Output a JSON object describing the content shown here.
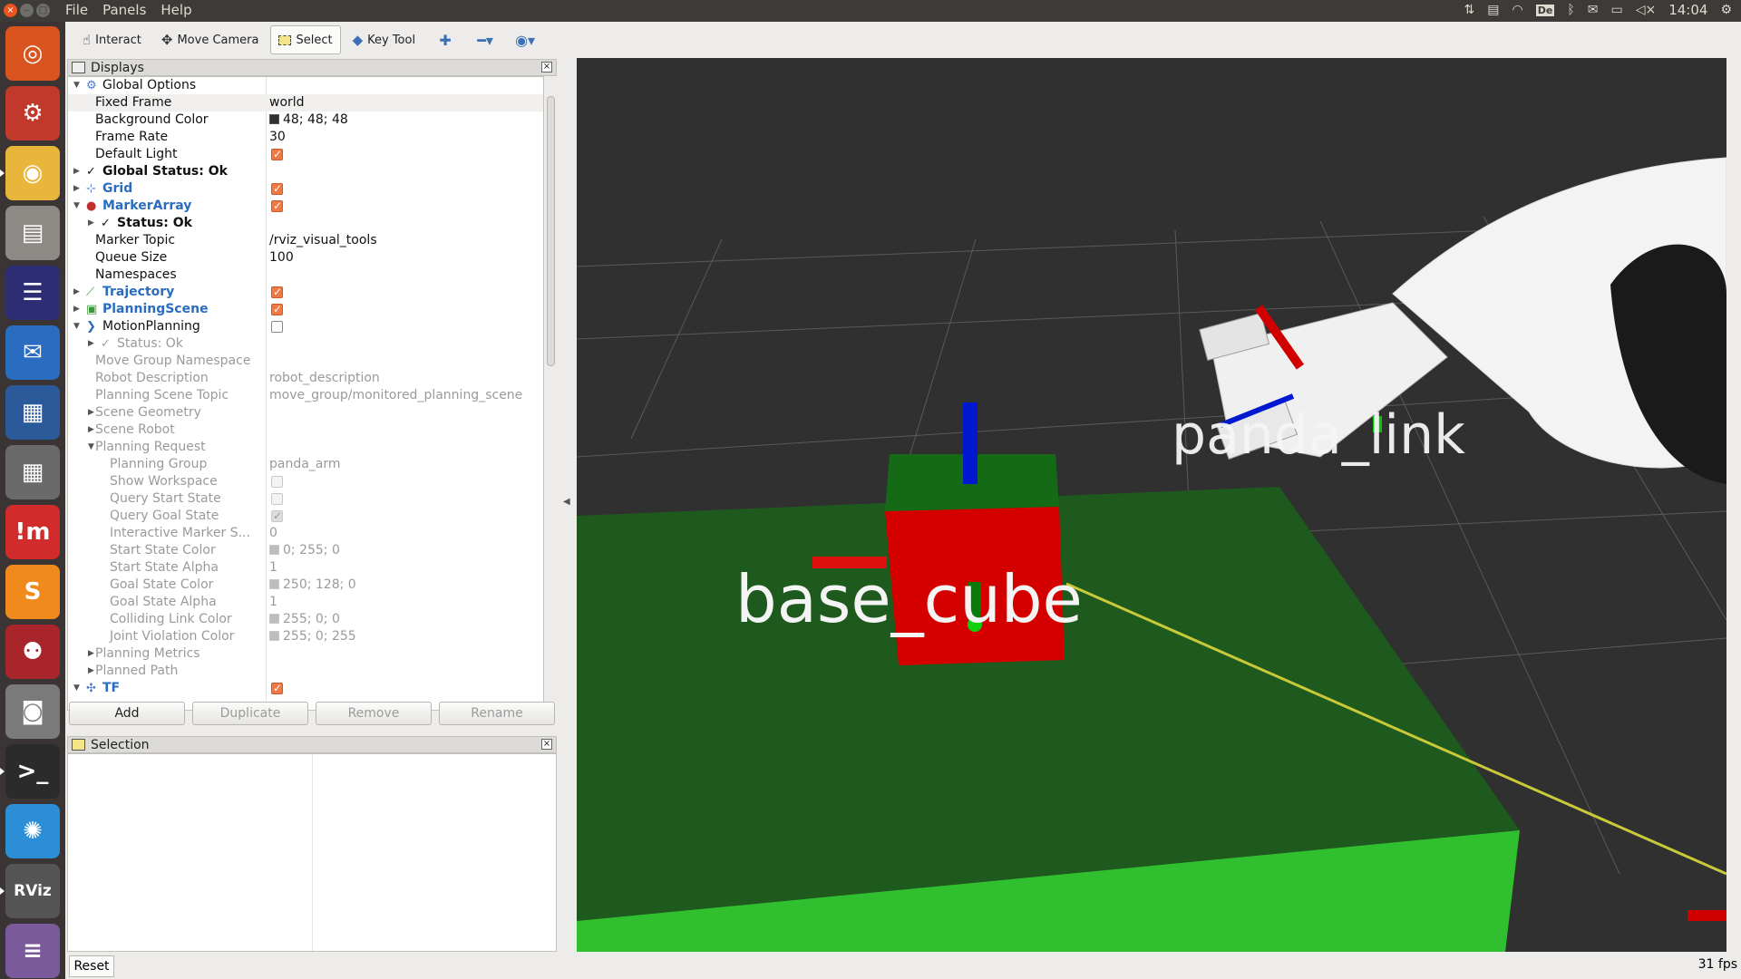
{
  "topbar": {
    "menus": [
      "File",
      "Panels",
      "Help"
    ],
    "keyboard_layout": "De",
    "clock": "14:04"
  },
  "launcher": [
    {
      "name": "ubuntu-dash",
      "glyph": "◎",
      "color": "#d9541e"
    },
    {
      "name": "system-settings",
      "glyph": "⚙",
      "color": "#c0392b"
    },
    {
      "name": "chrome",
      "glyph": "◉",
      "color": "#e8b63a"
    },
    {
      "name": "files",
      "glyph": "▤",
      "color": "#8d8a85"
    },
    {
      "name": "eclipse",
      "glyph": "☰",
      "color": "#2c2d72"
    },
    {
      "name": "thunderbird",
      "glyph": "✉",
      "color": "#2a6cbf"
    },
    {
      "name": "virtualbox",
      "glyph": "▦",
      "color": "#2a5a9a"
    },
    {
      "name": "calculator",
      "glyph": "▦",
      "color": "#6a6a6a"
    },
    {
      "name": "impress",
      "glyph": "!m",
      "color": "#d12b2b"
    },
    {
      "name": "sublime-text",
      "glyph": "S",
      "color": "#f08a1c"
    },
    {
      "name": "mendeley",
      "glyph": "⚉",
      "color": "#a8262b"
    },
    {
      "name": "camera",
      "glyph": "◙",
      "color": "#7a7a7a"
    },
    {
      "name": "terminal",
      "glyph": ">_",
      "color": "#2b2b2b"
    },
    {
      "name": "splash",
      "glyph": "✺",
      "color": "#2b8ed6"
    },
    {
      "name": "rviz",
      "glyph": "RViz",
      "color": "#555555"
    },
    {
      "name": "stack",
      "glyph": "≡",
      "color": "#7a5a9a"
    }
  ],
  "toolbar": {
    "interact": "Interact",
    "move_camera": "Move Camera",
    "select": "Select",
    "key_tool": "Key Tool"
  },
  "displays_panel": {
    "title": "Displays",
    "rows": [
      {
        "indent": 0,
        "arrow": "down",
        "icon": "⚙",
        "icon_color": "#4a7bd0",
        "label": "Global Options",
        "value": "",
        "style": "",
        "alt": false
      },
      {
        "indent": 1,
        "arrow": "",
        "icon": "",
        "label": "Fixed Frame",
        "value": "world",
        "style": "",
        "alt": true
      },
      {
        "indent": 1,
        "arrow": "",
        "icon": "",
        "label": "Background Color",
        "value": "48; 48; 48",
        "swatch": "#303030",
        "style": "",
        "alt": false
      },
      {
        "indent": 1,
        "arrow": "",
        "icon": "",
        "label": "Frame Rate",
        "value": "30",
        "style": "",
        "alt": false
      },
      {
        "indent": 1,
        "arrow": "",
        "icon": "",
        "label": "Default Light",
        "check": "on",
        "style": "",
        "alt": false
      },
      {
        "indent": 0,
        "arrow": "right",
        "icon": "✓",
        "icon_color": "#111",
        "label": "Global Status: Ok",
        "value": "",
        "style": "bold",
        "alt": false
      },
      {
        "indent": 0,
        "arrow": "right",
        "icon": "⊹",
        "icon_color": "#4a7bd0",
        "label": "Grid",
        "check": "on",
        "style": "blue",
        "alt": false
      },
      {
        "indent": 0,
        "arrow": "down",
        "icon": "●",
        "icon_color": "#c03030",
        "label": "MarkerArray",
        "check": "on",
        "style": "blue",
        "alt": false
      },
      {
        "indent": 1,
        "arrow": "right",
        "icon": "✓",
        "icon_color": "#111",
        "label": "Status: Ok",
        "value": "",
        "style": "bold",
        "alt": false
      },
      {
        "indent": 1,
        "arrow": "",
        "icon": "",
        "label": "Marker Topic",
        "value": "/rviz_visual_tools",
        "style": "",
        "alt": false
      },
      {
        "indent": 1,
        "arrow": "",
        "icon": "",
        "label": "Queue Size",
        "value": "100",
        "style": "",
        "alt": false
      },
      {
        "indent": 1,
        "arrow": "",
        "icon": "",
        "label": "Namespaces",
        "value": "",
        "style": "",
        "alt": false
      },
      {
        "indent": 0,
        "arrow": "right",
        "icon": "⟋",
        "icon_color": "#2aa52a",
        "label": "Trajectory",
        "check": "on",
        "style": "blue",
        "alt": false
      },
      {
        "indent": 0,
        "arrow": "right",
        "icon": "▣",
        "icon_color": "#3a9a3a",
        "label": "PlanningScene",
        "check": "on",
        "style": "blue",
        "alt": false
      },
      {
        "indent": 0,
        "arrow": "down",
        "icon": "❯",
        "icon_color": "#2a6cbf",
        "label": "MotionPlanning",
        "check": "off",
        "style": "",
        "alt": false
      },
      {
        "indent": 1,
        "arrow": "right",
        "icon": "✓",
        "icon_color": "#9a9a9a",
        "label": "Status: Ok",
        "value": "",
        "style": "",
        "dis": true,
        "alt": false
      },
      {
        "indent": 1,
        "arrow": "",
        "icon": "",
        "label": "Move Group Namespace",
        "value": "",
        "dis": true,
        "alt": false
      },
      {
        "indent": 1,
        "arrow": "",
        "icon": "",
        "label": "Robot Description",
        "value": "robot_description",
        "dis": true,
        "alt": false
      },
      {
        "indent": 1,
        "arrow": "",
        "icon": "",
        "label": "Planning Scene Topic",
        "value": "move_group/monitored_planning_scene",
        "dis": true,
        "alt": false
      },
      {
        "indent": 1,
        "arrow": "right",
        "icon": "",
        "label": "Scene Geometry",
        "value": "",
        "dis": true,
        "alt": false
      },
      {
        "indent": 1,
        "arrow": "right",
        "icon": "",
        "label": "Scene Robot",
        "value": "",
        "dis": true,
        "alt": false
      },
      {
        "indent": 1,
        "arrow": "down",
        "icon": "",
        "label": "Planning Request",
        "value": "",
        "dis": true,
        "alt": false
      },
      {
        "indent": 2,
        "arrow": "",
        "icon": "",
        "label": "Planning Group",
        "value": "panda_arm",
        "dis": true,
        "alt": false
      },
      {
        "indent": 2,
        "arrow": "",
        "icon": "",
        "label": "Show Workspace",
        "check": "off",
        "dis": true,
        "alt": false
      },
      {
        "indent": 2,
        "arrow": "",
        "icon": "",
        "label": "Query Start State",
        "check": "off",
        "dis": true,
        "alt": false
      },
      {
        "indent": 2,
        "arrow": "",
        "icon": "",
        "label": "Query Goal State",
        "check": "on",
        "dis": true,
        "alt": false
      },
      {
        "indent": 2,
        "arrow": "",
        "icon": "",
        "label": "Interactive Marker S...",
        "value": "0",
        "dis": true,
        "alt": false
      },
      {
        "indent": 2,
        "arrow": "",
        "icon": "",
        "label": "Start State Color",
        "value": "0; 255; 0",
        "swatch": "#bdbdbd",
        "dis": true,
        "alt": false
      },
      {
        "indent": 2,
        "arrow": "",
        "icon": "",
        "label": "Start State Alpha",
        "value": "1",
        "dis": true,
        "alt": false
      },
      {
        "indent": 2,
        "arrow": "",
        "icon": "",
        "label": "Goal State Color",
        "value": "250; 128; 0",
        "swatch": "#bdbdbd",
        "dis": true,
        "alt": false
      },
      {
        "indent": 2,
        "arrow": "",
        "icon": "",
        "label": "Goal State Alpha",
        "value": "1",
        "dis": true,
        "alt": false
      },
      {
        "indent": 2,
        "arrow": "",
        "icon": "",
        "label": "Colliding Link Color",
        "value": "255; 0; 0",
        "swatch": "#bdbdbd",
        "dis": true,
        "alt": false
      },
      {
        "indent": 2,
        "arrow": "",
        "icon": "",
        "label": "Joint Violation Color",
        "value": "255; 0; 255",
        "swatch": "#bdbdbd",
        "dis": true,
        "alt": false
      },
      {
        "indent": 1,
        "arrow": "right",
        "icon": "",
        "label": "Planning Metrics",
        "value": "",
        "dis": true,
        "alt": false
      },
      {
        "indent": 1,
        "arrow": "right",
        "icon": "",
        "label": "Planned Path",
        "value": "",
        "dis": true,
        "alt": false
      },
      {
        "indent": 0,
        "arrow": "down",
        "icon": "✣",
        "icon_color": "#4a7bd0",
        "label": "TF",
        "check": "on",
        "style": "blue",
        "alt": false
      }
    ],
    "buttons": {
      "add": "Add",
      "duplicate": "Duplicate",
      "remove": "Remove",
      "rename": "Rename"
    }
  },
  "selection_panel": {
    "title": "Selection"
  },
  "viewport": {
    "label_base_cube": "base_cube",
    "label_panda_link": "panda_link",
    "background_color": "#303030"
  },
  "statusbar": {
    "reset": "Reset",
    "fps": "31 fps"
  }
}
